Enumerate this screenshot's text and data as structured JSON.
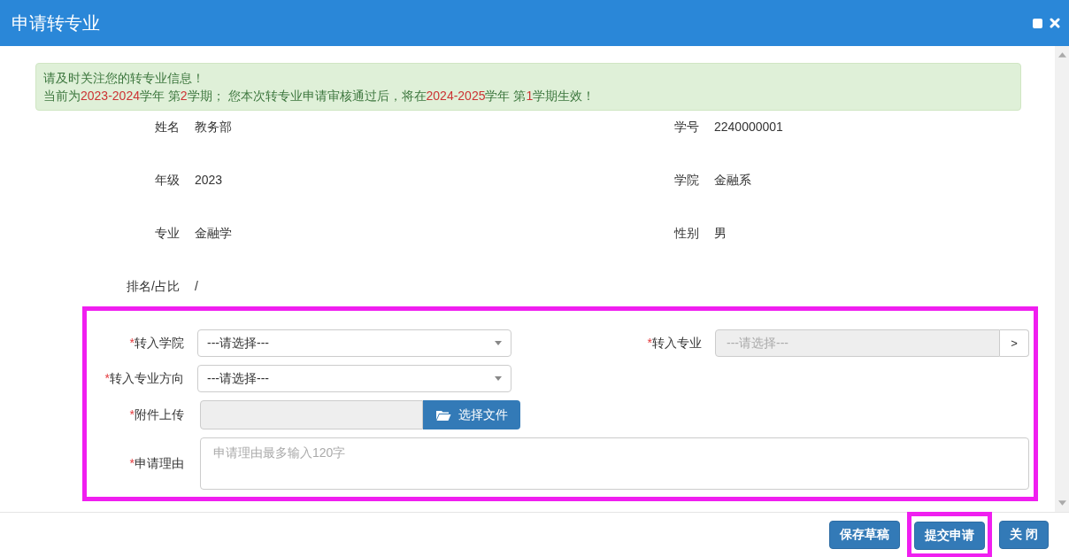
{
  "dialog": {
    "title": "申请转专业"
  },
  "notice": {
    "lines": [
      [
        {
          "text": "请及时关注您的转专业信息！",
          "highlight": false
        }
      ],
      [
        {
          "text": "当前为",
          "highlight": false
        },
        {
          "text": "2023-2024",
          "highlight": true
        },
        {
          "text": "学年 第",
          "highlight": false
        },
        {
          "text": "2",
          "highlight": true
        },
        {
          "text": "学期； 您本次转专业申请审核通过后，将在",
          "highlight": false
        },
        {
          "text": "2024-2025",
          "highlight": true
        },
        {
          "text": "学年 第",
          "highlight": false
        },
        {
          "text": "1",
          "highlight": true
        },
        {
          "text": "学期生效！",
          "highlight": false
        }
      ]
    ]
  },
  "info": [
    {
      "label": "姓名",
      "value": "教务部"
    },
    {
      "label": "学号",
      "value": "2240000001"
    },
    {
      "label": "年级",
      "value": "2023"
    },
    {
      "label": "学院",
      "value": "金融系"
    },
    {
      "label": "专业",
      "value": "金融学"
    },
    {
      "label": "性别",
      "value": "男"
    },
    {
      "label": "排名/占比",
      "value": "/"
    }
  ],
  "form": {
    "highlighted": true,
    "rows": [
      [
        {
          "kind": "select",
          "required_mark": "*",
          "label": "转入学院",
          "value": "---请选择---",
          "disabled": false
        },
        {
          "kind": "picker",
          "required_mark": "*",
          "label": "转入专业",
          "placeholder": "---请选择---",
          "disabled": true,
          "button": ">"
        }
      ],
      [
        {
          "kind": "select",
          "required_mark": "*",
          "label": "转入专业方向",
          "value": "---请选择---",
          "disabled": false
        }
      ],
      [
        {
          "kind": "file",
          "required_mark": "*",
          "label": "附件上传",
          "button": "选择文件"
        }
      ],
      [
        {
          "kind": "textarea",
          "required_mark": "*",
          "label": "申请理由",
          "placeholder": "申请理由最多输入120字"
        }
      ]
    ]
  },
  "buttons": [
    {
      "label": "保存草稿",
      "highlighted": false
    },
    {
      "label": "提交申请",
      "highlighted": true
    },
    {
      "label": "关 闭",
      "highlighted": false
    }
  ]
}
